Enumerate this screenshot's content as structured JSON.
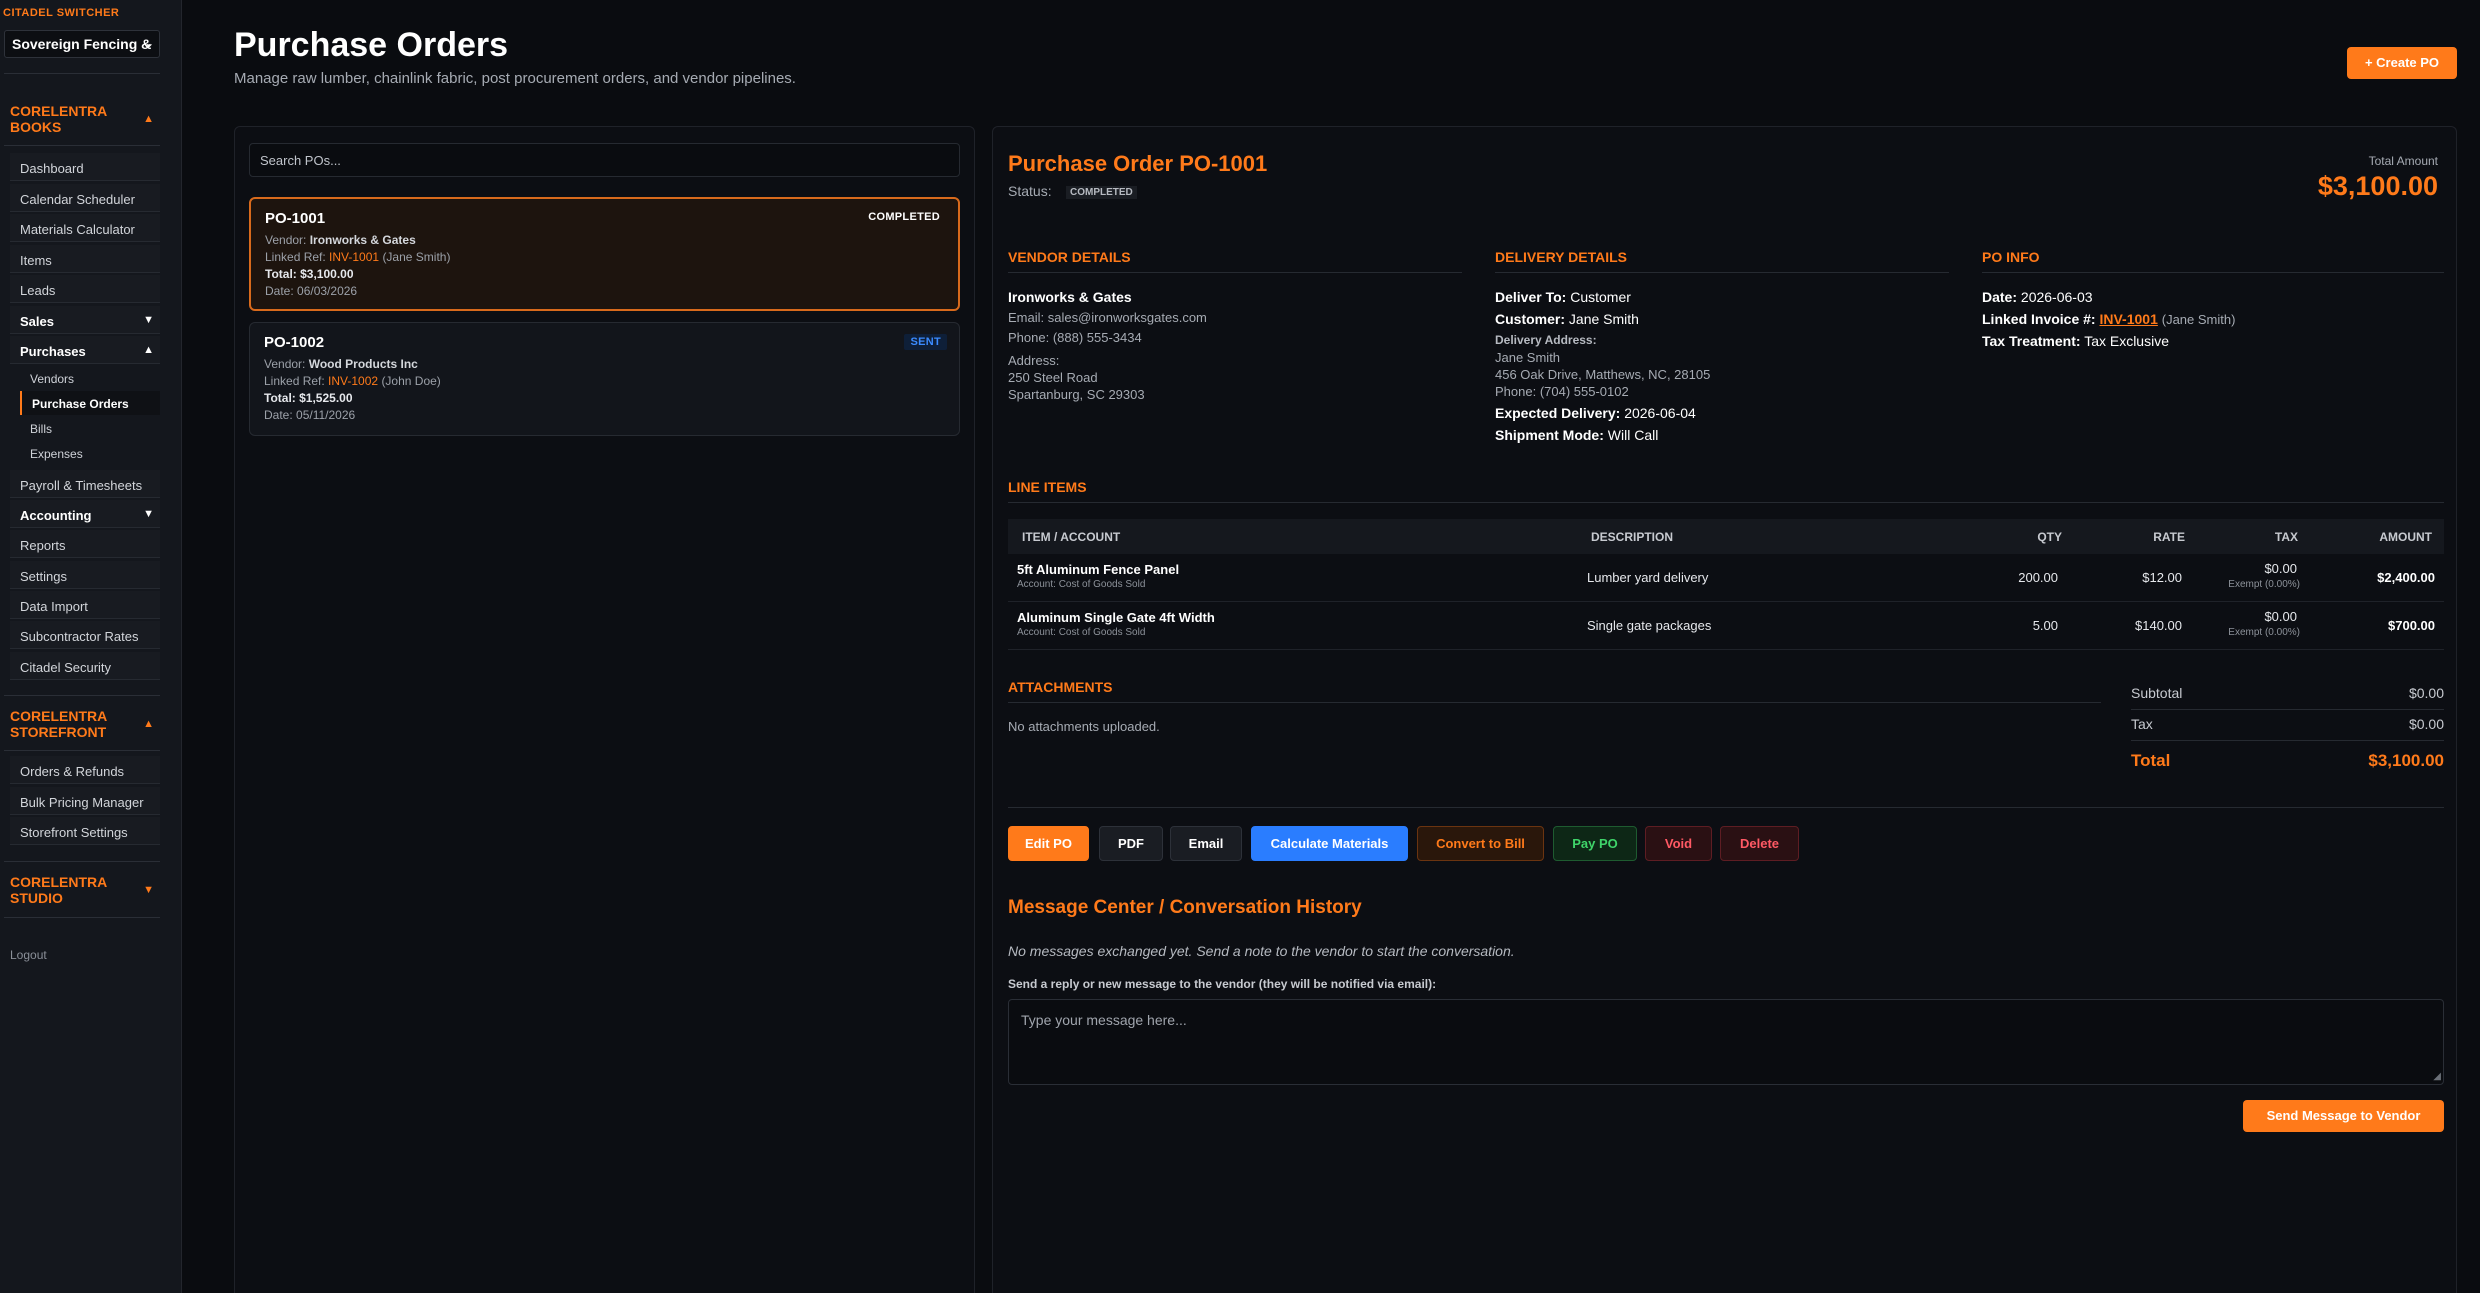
{
  "sidebar": {
    "switcher_label": "CITADEL SWITCHER",
    "switcher_value": "Sovereign Fencing &",
    "books": {
      "heading_line1": "CORELENTRA",
      "heading_line2": "BOOKS",
      "items": [
        "Dashboard",
        "Calendar Scheduler",
        "Materials Calculator",
        "Items",
        "Leads"
      ],
      "sales": "Sales",
      "purchases": "Purchases",
      "purchases_sub": [
        "Vendors",
        "Purchase Orders",
        "Bills",
        "Expenses"
      ],
      "payroll": "Payroll & Timesheets",
      "accounting": "Accounting",
      "after": [
        "Reports",
        "Settings",
        "Data Import",
        "Subcontractor Rates",
        "Citadel Security"
      ]
    },
    "storefront": {
      "heading_line1": "CORELENTRA",
      "heading_line2": "STOREFRONT",
      "items": [
        "Orders & Refunds",
        "Bulk Pricing Manager",
        "Storefront Settings"
      ]
    },
    "studio": {
      "heading_line1": "CORELENTRA",
      "heading_line2": "STUDIO"
    },
    "logout": "Logout",
    "arrow_up": "▲",
    "arrow_down": "▼"
  },
  "header": {
    "title": "Purchase Orders",
    "subtitle": "Manage raw lumber, chainlink fabric, post procurement orders, and vendor pipelines.",
    "create_button": "+ Create PO"
  },
  "list": {
    "search_placeholder": "Search POs...",
    "orders": [
      {
        "number": "PO-1001",
        "status": "COMPLETED",
        "vendor_label": "Vendor:",
        "vendor": "Ironworks & Gates",
        "linked_label": "Linked Ref:",
        "linked_ref": "INV-1001",
        "linked_person": "(Jane Smith)",
        "total_label": "Total:",
        "total": "$3,100.00",
        "date_label": "Date:",
        "date": "06/03/2026"
      },
      {
        "number": "PO-1002",
        "status": "SENT",
        "vendor_label": "Vendor:",
        "vendor": "Wood Products Inc",
        "linked_label": "Linked Ref:",
        "linked_ref": "INV-1002",
        "linked_person": "(John Doe)",
        "total_label": "Total:",
        "total": "$1,525.00",
        "date_label": "Date:",
        "date": "05/11/2026"
      }
    ]
  },
  "detail": {
    "title": "Purchase Order PO-1001",
    "status_label": "Status:",
    "status": "COMPLETED",
    "total_label": "Total Amount",
    "total": "$3,100.00",
    "vendor": {
      "heading": "VENDOR DETAILS",
      "name": "Ironworks & Gates",
      "email": "Email: sales@ironworksgates.com",
      "phone": "Phone: (888) 555-3434",
      "address_label": "Address:",
      "address_1": "250 Steel Road",
      "address_2": "Spartanburg, SC 29303"
    },
    "delivery": {
      "heading": "DELIVERY DETAILS",
      "deliver_to_label": "Deliver To:",
      "deliver_to": "Customer",
      "customer_label": "Customer:",
      "customer": "Jane Smith",
      "address_label": "Delivery Address:",
      "address_1": "Jane Smith",
      "address_2": "456 Oak Drive, Matthews, NC, 28105",
      "phone": "Phone: (704) 555-0102",
      "expected_label": "Expected Delivery:",
      "expected": "2026-06-04",
      "shipment_label": "Shipment Mode:",
      "shipment": "Will Call"
    },
    "po_info": {
      "heading": "PO INFO",
      "date_label": "Date:",
      "date": "2026-06-03",
      "linked_label": "Linked Invoice #:",
      "linked": "INV-1001",
      "linked_person": "(Jane Smith)",
      "tax_label": "Tax Treatment:",
      "tax": "Tax Exclusive"
    },
    "line_items": {
      "heading": "LINE ITEMS",
      "columns": [
        "ITEM / ACCOUNT",
        "DESCRIPTION",
        "QTY",
        "RATE",
        "TAX",
        "AMOUNT"
      ],
      "rows": [
        {
          "item": "5ft Aluminum Fence Panel",
          "account": "Account: Cost of Goods Sold",
          "description": "Lumber yard delivery",
          "qty": "200.00",
          "rate": "$12.00",
          "tax": "$0.00",
          "tax_note": "Exempt (0.00%)",
          "amount": "$2,400.00"
        },
        {
          "item": "Aluminum Single Gate 4ft Width",
          "account": "Account: Cost of Goods Sold",
          "description": "Single gate packages",
          "qty": "5.00",
          "rate": "$140.00",
          "tax": "$0.00",
          "tax_note": "Exempt (0.00%)",
          "amount": "$700.00"
        }
      ]
    },
    "attachments": {
      "heading": "ATTACHMENTS",
      "empty": "No attachments uploaded."
    },
    "totals": {
      "subtotal_label": "Subtotal",
      "subtotal": "$0.00",
      "tax_label": "Tax",
      "tax": "$0.00",
      "total_label": "Total",
      "total": "$3,100.00"
    },
    "actions": {
      "edit": "Edit PO",
      "pdf": "PDF",
      "email": "Email",
      "calc": "Calculate Materials",
      "convert": "Convert to Bill",
      "pay": "Pay PO",
      "void": "Void",
      "delete": "Delete"
    },
    "messages": {
      "heading": "Message Center / Conversation History",
      "empty": "No messages exchanged yet. Send a note to the vendor to start the conversation.",
      "label": "Send a reply or new message to the vendor (they will be notified via email):",
      "placeholder": "Type your message here...",
      "send": "Send Message to Vendor"
    }
  },
  "colors": {
    "accent": "#ff7a1a",
    "background": "#0a0c10",
    "panel": "#0c0e13",
    "blue_button": "#2a7dff",
    "pay_green": "#3fd46a",
    "void_red": "#ff5964"
  }
}
